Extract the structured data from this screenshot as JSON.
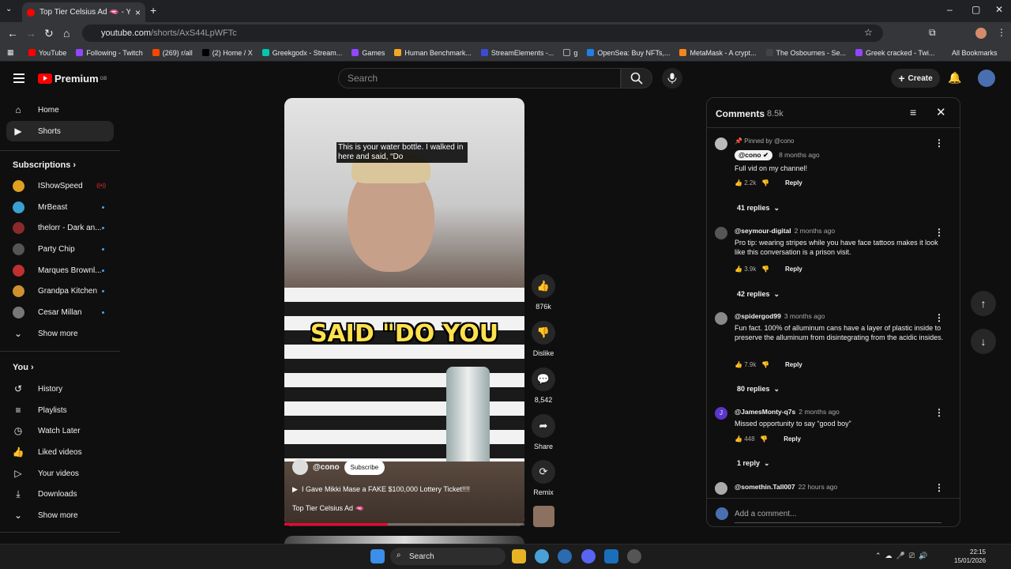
{
  "browser": {
    "tab_title": "Top Tier Celsius Ad 🫦 - Yo",
    "url_host": "youtube.com",
    "url_path": "/shorts/AxS44LpWFTc",
    "bookmarks": [
      {
        "label": "YouTube",
        "color": "#ff0000"
      },
      {
        "label": "Following - Twitch",
        "color": "#9146ff"
      },
      {
        "label": "(269) r/all",
        "color": "#ff4500"
      },
      {
        "label": "(2) Home / X",
        "color": "#000000"
      },
      {
        "label": "Greekgodx - Stream...",
        "color": "#00c8af"
      },
      {
        "label": "Games",
        "color": "#9146ff"
      },
      {
        "label": "Human Benchmark...",
        "color": "#f5a623"
      },
      {
        "label": "StreamElements -...",
        "color": "#3b4bd8"
      },
      {
        "label": "g",
        "color": "#999999"
      },
      {
        "label": "OpenSea: Buy NFTs,...",
        "color": "#2081e2"
      },
      {
        "label": "MetaMask - A crypt...",
        "color": "#f6851b"
      },
      {
        "label": "The Osbournes - Se...",
        "color": "#444444"
      },
      {
        "label": "Greek cracked - Twi...",
        "color": "#9146ff"
      }
    ],
    "all_bookmarks": "All Bookmarks"
  },
  "header": {
    "logo": "Premium",
    "logo_region": "GB",
    "search_placeholder": "Search",
    "create_label": "Create"
  },
  "sidebar": {
    "main": [
      {
        "label": "Home",
        "icon": "home-icon"
      },
      {
        "label": "Shorts",
        "icon": "shorts-icon",
        "active": true
      }
    ],
    "subscriptions_header": "Subscriptions",
    "subscriptions": [
      {
        "label": "IShowSpeed",
        "color": "#e0a020",
        "live": true
      },
      {
        "label": "MrBeast",
        "color": "#3aa0d0"
      },
      {
        "label": "thelorr - Dark an...",
        "color": "#8a2a2a"
      },
      {
        "label": "Party Chip",
        "color": "#555555"
      },
      {
        "label": "Marques Brownl...",
        "color": "#c03030"
      },
      {
        "label": "Grandpa Kitchen",
        "color": "#d09030"
      },
      {
        "label": "Cesar Millan",
        "color": "#777777"
      }
    ],
    "subs_show_more": "Show more",
    "you_header": "You",
    "you_items": [
      {
        "label": "History",
        "icon": "history-icon"
      },
      {
        "label": "Playlists",
        "icon": "playlists-icon"
      },
      {
        "label": "Watch Later",
        "icon": "clock-icon"
      },
      {
        "label": "Liked videos",
        "icon": "like-icon"
      },
      {
        "label": "Your videos",
        "icon": "video-icon"
      },
      {
        "label": "Downloads",
        "icon": "download-icon"
      }
    ],
    "you_show_more": "Show more"
  },
  "video": {
    "caption": "This is your water bottle. I walked in here and said, “Do",
    "overlay_text": "SAID \"DO YOU",
    "channel": "@cono",
    "subscribe": "Subscribe",
    "title": "I Gave Mikki Mase a FAKE $100,000 Lottery Ticket!!!!",
    "tag": "Top Tier Celsius Ad 🫦",
    "progress_fraction": 0.43
  },
  "actions": {
    "likes": "876k",
    "dislike": "Dislike",
    "comments": "8,542",
    "share": "Share",
    "remix": "Remix"
  },
  "comments": {
    "title": "Comments",
    "count": "8.5k",
    "items": [
      {
        "pinned": "Pinned by @cono",
        "user": "@cono",
        "age": "8 months ago",
        "text": "Full vid on my channel!",
        "likes": "2.2k",
        "replies": "41 replies",
        "color": "#bbbbbb"
      },
      {
        "user": "@seymour-digital",
        "age": "2 months ago",
        "text": "Pro tip: wearing stripes while you have face tattoos makes it look like this conversation is a prison visit.",
        "likes": "3.9k",
        "replies": "42 replies",
        "color": "#555555"
      },
      {
        "user": "@spidergod99",
        "age": "3 months ago",
        "text": "Fun fact. 100% of alluminum cans have a layer of plastic inside to preserve the alluminum from disintegrating from the acidic insides.",
        "likes": "7.9k",
        "replies": "80 replies",
        "color": "#888888"
      },
      {
        "user": "@JamesMonty-q7s",
        "age": "2 months ago",
        "text": "Missed opportunity to say “good boy”",
        "likes": "448",
        "replies": "1 reply",
        "color": "#5c35cc"
      },
      {
        "user": "@somethin.Tall007",
        "age": "22 hours ago",
        "text": "",
        "color": "#aaaaaa"
      }
    ],
    "reply_label": "Reply",
    "add_placeholder": "Add a comment..."
  },
  "taskbar": {
    "search": "Search",
    "time": "22:15",
    "date": "15/01/2026"
  }
}
